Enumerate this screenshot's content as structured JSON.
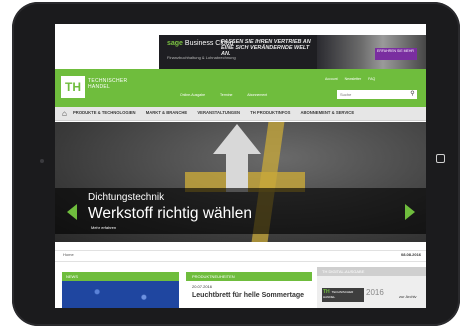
{
  "ad": {
    "brand": "sage",
    "brand_rest": " Business Cloud",
    "sub": "Finanzbuchhaltung & Lohnabrechnung",
    "headline": "PASSEN SIE IHREN VERTRIEB AN EINE SICH VERÄNDERNDE WELT AN.",
    "cta": "ERFAHREN SIE MEHR"
  },
  "header": {
    "logo": "TH",
    "logo_text_1": "TECHNISCHER",
    "logo_text_2": "HANDEL",
    "top_links": [
      "Account",
      "Newsletter",
      "FAQ"
    ],
    "mini_nav": [
      "Online-Ausgabe",
      "Termine",
      "Abonnement"
    ],
    "search_placeholder": "Suche"
  },
  "mainnav": {
    "items": [
      "PRODUKTE & TECHNOLOGIEN",
      "MARKT & BRANCHE",
      "VERANSTALTUNGEN",
      "TH PRODUKTINFOS",
      "ABONNEMENT & SERVICE"
    ]
  },
  "hero": {
    "subtitle": "Dichtungstechnik",
    "title": "Werkstoff richtig wählen",
    "link": "Mehr erfahren"
  },
  "datebar": {
    "left": "Home",
    "right": "08.08.2016"
  },
  "boxes": {
    "news_label": "NEWS",
    "product_label": "PRODUKTNEUHEITEN",
    "product_date": "20.07.2016",
    "product_title": "Leuchtbrett für helle Sommertage",
    "archive_label": "TH DIGITAL-AUSGABE",
    "archive_logo": "TH",
    "archive_logo_text": "TECHNISCHER HANDEL",
    "archive_year": "2016",
    "archive_link": "zur Archiv"
  },
  "colors": {
    "accent": "#6fbd3d",
    "tablet": "#1b1b1d"
  }
}
